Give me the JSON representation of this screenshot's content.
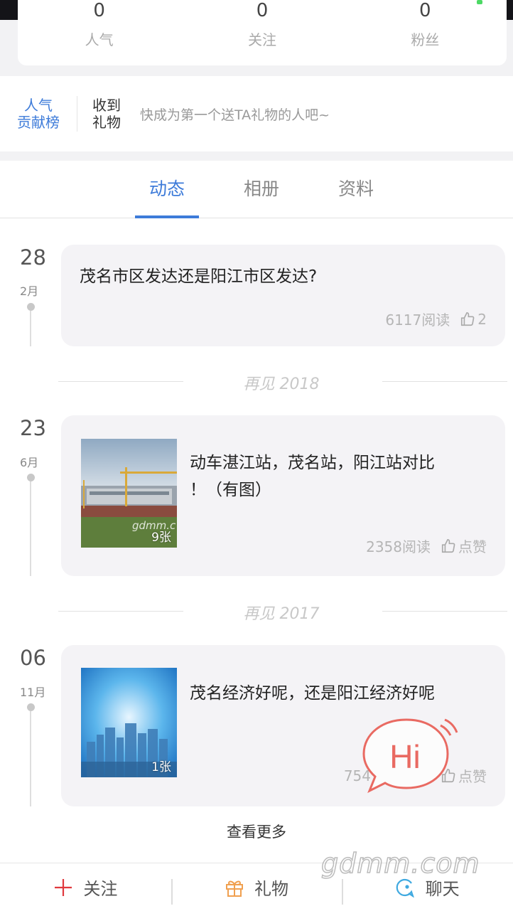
{
  "profile_stats": [
    {
      "value": "0",
      "label": "人气"
    },
    {
      "value": "0",
      "label": "关注"
    },
    {
      "value": "0",
      "label": "粉丝"
    }
  ],
  "gift_bar": {
    "rank_line1": "人气",
    "rank_line2": "贡献榜",
    "recv_line1": "收到",
    "recv_line2": "礼物",
    "hint": "快成为第一个送TA礼物的人吧~"
  },
  "tabs": [
    {
      "label": "动态",
      "active": true
    },
    {
      "label": "相册",
      "active": false
    },
    {
      "label": "资料",
      "active": false
    }
  ],
  "posts": [
    {
      "day": "28",
      "month": "2月",
      "title": "茂名市区发达还是阳江市区发达?",
      "reads": "6117阅读",
      "likes": "2"
    },
    {
      "day": "23",
      "month": "6月",
      "title_line1": "动车湛江站，茂名站，阳江站对比",
      "title_line2": "！（有图）",
      "reads": "2358阅读",
      "likes": "点赞",
      "image_count": "9张",
      "image_watermark": "gdmm.c"
    },
    {
      "day": "06",
      "month": "11月",
      "title": "茂名经济好呢，还是阳江经济好呢",
      "reads": "754",
      "likes": "点赞",
      "image_count": "1张"
    }
  ],
  "year_separators": [
    "再见 2018",
    "再见 2017"
  ],
  "see_more": "查看更多",
  "bottom_nav": [
    {
      "label": "关注",
      "icon": "plus-icon"
    },
    {
      "label": "礼物",
      "icon": "gift-icon"
    },
    {
      "label": "聊天",
      "icon": "chat-icon"
    }
  ],
  "hi_bubble_text": "Hi",
  "watermark": "gdmm.com",
  "colors": {
    "accent": "#3d7bd9",
    "follow_red": "#e0393e",
    "gift_orange": "#f0a050",
    "chat_blue": "#3fa9e0",
    "hi_red": "#e96a62"
  }
}
